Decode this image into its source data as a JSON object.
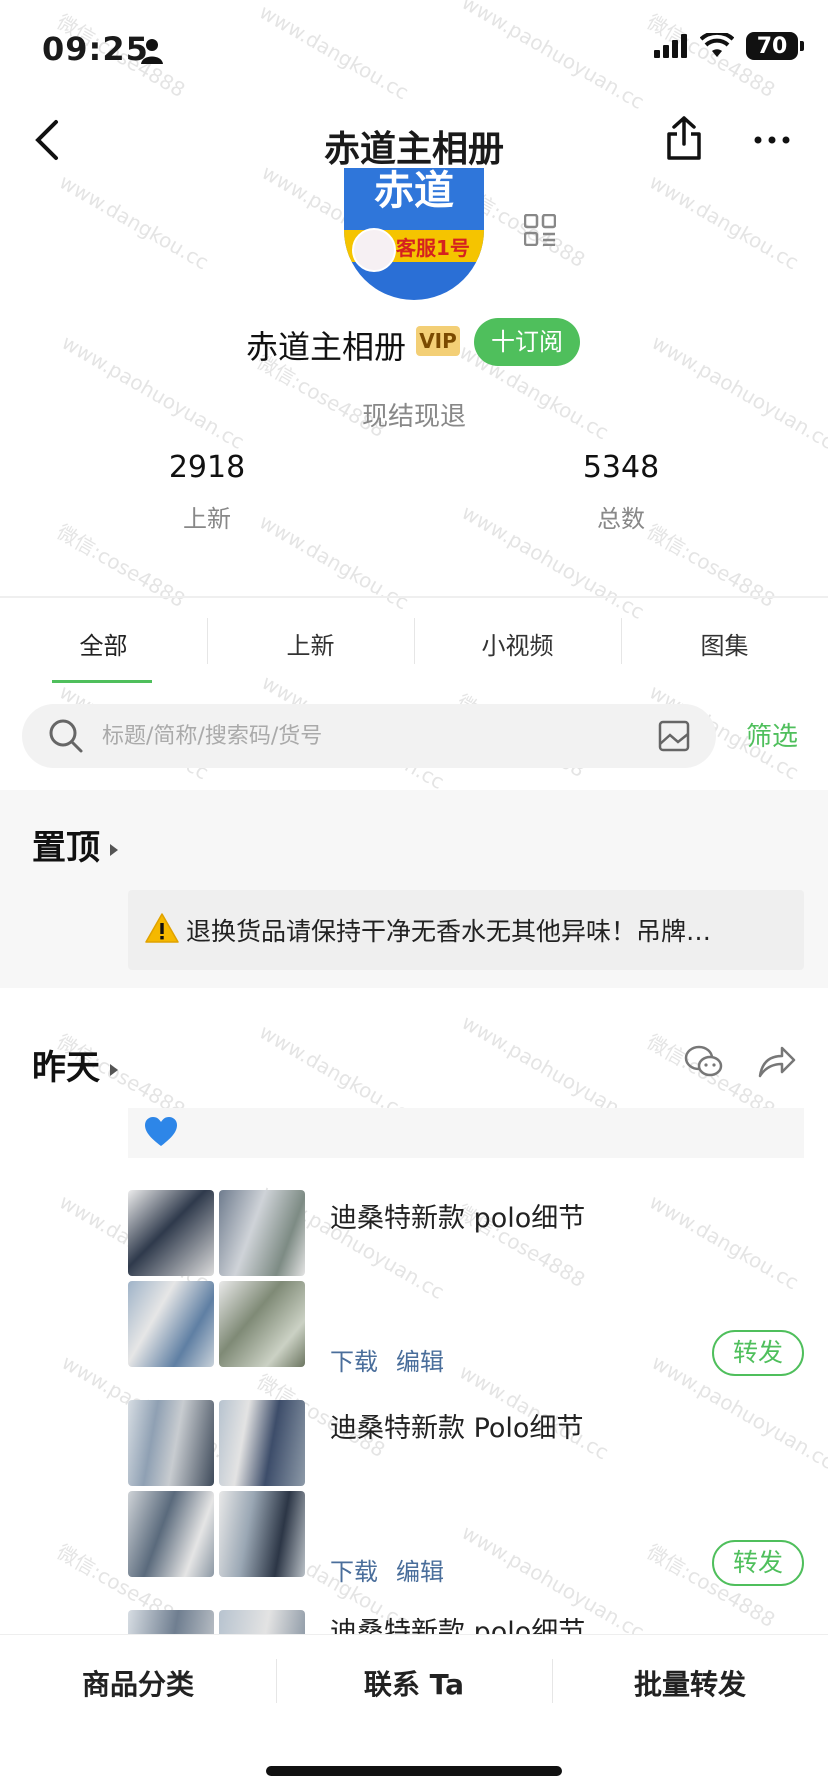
{
  "status": {
    "time": "09:25",
    "battery": "70"
  },
  "nav": {
    "title": "赤道主相册"
  },
  "profile": {
    "avatar_top_text": "赤道",
    "avatar_label": "客服1号",
    "name": "赤道主相册",
    "vip": "VIP",
    "subscribe": "十订阅",
    "motto": "现结现退",
    "stats": [
      {
        "value": "2918",
        "label": "上新"
      },
      {
        "value": "5348",
        "label": "总数"
      }
    ]
  },
  "tabs": [
    "全部",
    "上新",
    "小视频",
    "图集"
  ],
  "search": {
    "placeholder": "标题/简称/搜索码/货号",
    "filter": "筛选"
  },
  "pinned": {
    "title": "置顶",
    "notice": "退换货品请保持干净无香水无其他异味！吊牌…"
  },
  "yesterday": {
    "title": "昨天",
    "items": [
      {
        "title": "迪桑特新款 polo细节",
        "download": "下载",
        "edit": "编辑",
        "forward": "转发"
      },
      {
        "title": "迪桑特新款 Polo细节",
        "download": "下载",
        "edit": "编辑",
        "forward": "转发"
      },
      {
        "title": "迪桑特新款 polo细节"
      }
    ]
  },
  "bottom": [
    "商品分类",
    "联系 Ta",
    "批量转发"
  ],
  "watermarks": [
    "微信:cose4888",
    "www.dangkou.cc",
    "www.paohuoyuan.cc"
  ],
  "colors": {
    "accent": "#4fbf5c",
    "link": "#4a6e9b",
    "vip": "#f3cf76",
    "avatar_blue": "#2f76da",
    "avatar_yellow": "#f5c400"
  }
}
